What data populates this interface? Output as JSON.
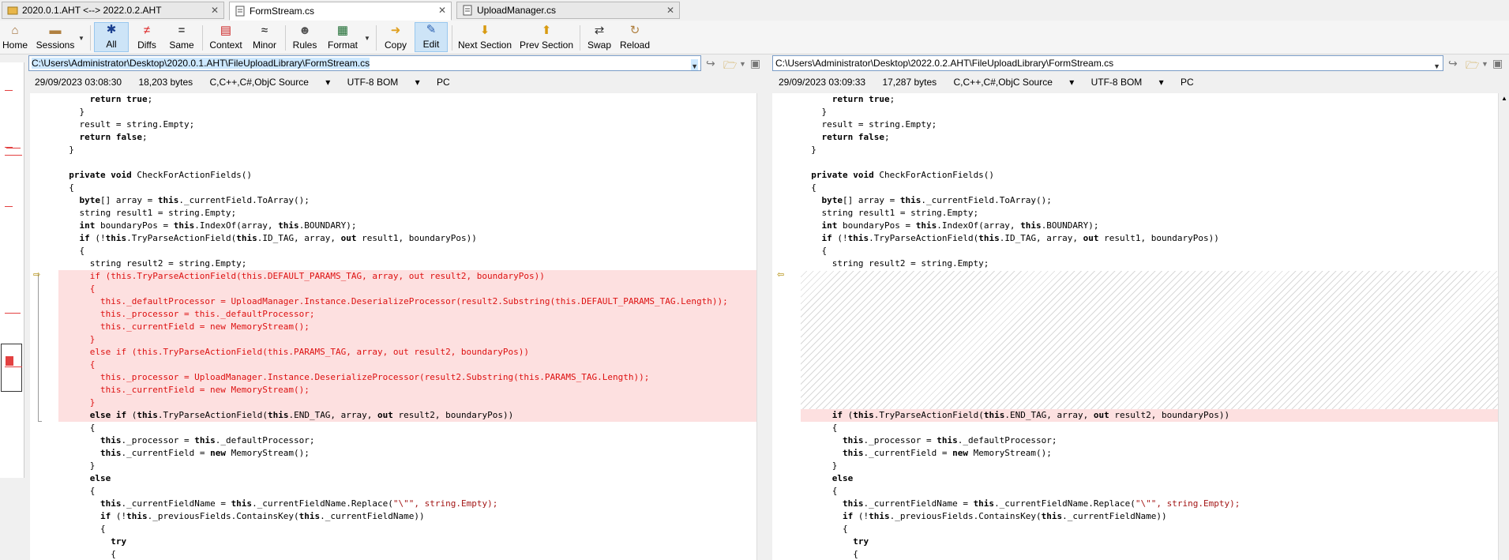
{
  "tabs": [
    {
      "label": "2020.0.1.AHT <--> 2022.0.2.AHT",
      "active": false
    },
    {
      "label": "FormStream.cs",
      "active": true
    },
    {
      "label": "UploadManager.cs",
      "active": false
    }
  ],
  "toolbar": {
    "home": "Home",
    "sessions": "Sessions",
    "all": "All",
    "diffs": "Diffs",
    "same": "Same",
    "context": "Context",
    "minor": "Minor",
    "rules": "Rules",
    "format": "Format",
    "copy": "Copy",
    "edit": "Edit",
    "next_section": "Next Section",
    "prev_section": "Prev Section",
    "swap": "Swap",
    "reload": "Reload"
  },
  "left": {
    "path": "C:\\Users\\Administrator\\Desktop\\2020.0.1.AHT\\FileUploadLibrary\\FormStream.cs",
    "date": "29/09/2023 03:08:30",
    "size": "18,203 bytes",
    "format": "C,C++,C#,ObjC Source",
    "encoding": "UTF-8 BOM",
    "eol": "PC",
    "lines": [
      "      return true;",
      "    }",
      "    result = string.Empty;",
      "    return false;",
      "  }",
      "",
      "  private void CheckForActionFields()",
      "  {",
      "    byte[] array = this._currentField.ToArray();",
      "    string result1 = string.Empty;",
      "    int boundaryPos = this.IndexOf(array, this.BOUNDARY);",
      "    if (!this.TryParseActionField(this.ID_TAG, array, out result1, boundaryPos))",
      "    {",
      "      string result2 = string.Empty;",
      "      if (this.TryParseActionField(this.DEFAULT_PARAMS_TAG, array, out result2, boundaryPos))",
      "      {",
      "        this._defaultProcessor = UploadManager.Instance.DeserializeProcessor(result2.Substring(this.DEFAULT_PARAMS_TAG.Length));",
      "        this._processor = this._defaultProcessor;",
      "        this._currentField = new MemoryStream();",
      "      }",
      "      else if (this.TryParseActionField(this.PARAMS_TAG, array, out result2, boundaryPos))",
      "      {",
      "        this._processor = UploadManager.Instance.DeserializeProcessor(result2.Substring(this.PARAMS_TAG.Length));",
      "        this._currentField = new MemoryStream();",
      "      }",
      "      else if (this.TryParseActionField(this.END_TAG, array, out result2, boundaryPos))",
      "      {",
      "        this._processor = this._defaultProcessor;",
      "        this._currentField = new MemoryStream();",
      "      }",
      "      else",
      "      {",
      "        this._currentFieldName = this._currentFieldName.Replace(\"\\\"\", string.Empty);",
      "        if (!this._previousFields.ContainsKey(this._currentFieldName))",
      "        {",
      "          try",
      "          {"
    ]
  },
  "right": {
    "path": "C:\\Users\\Administrator\\Desktop\\2022.0.2.AHT\\FileUploadLibrary\\FormStream.cs",
    "date": "29/09/2023 03:09:33",
    "size": "17,287 bytes",
    "format": "C,C++,C#,ObjC Source",
    "encoding": "UTF-8 BOM",
    "eol": "PC",
    "lines_top": [
      "      return true;",
      "    }",
      "    result = string.Empty;",
      "    return false;",
      "  }",
      "",
      "  private void CheckForActionFields()",
      "  {",
      "    byte[] array = this._currentField.ToArray();",
      "    string result1 = string.Empty;",
      "    int boundaryPos = this.IndexOf(array, this.BOUNDARY);",
      "    if (!this.TryParseActionField(this.ID_TAG, array, out result1, boundaryPos))",
      "    {",
      "      string result2 = string.Empty;"
    ],
    "lines_bottom": [
      "      if (this.TryParseActionField(this.END_TAG, array, out result2, boundaryPos))",
      "      {",
      "        this._processor = this._defaultProcessor;",
      "        this._currentField = new MemoryStream();",
      "      }",
      "      else",
      "      {",
      "        this._currentFieldName = this._currentFieldName.Replace(\"\\\"\", string.Empty);",
      "        if (!this._previousFields.ContainsKey(this._currentFieldName))",
      "        {",
      "          try",
      "          {"
    ]
  }
}
